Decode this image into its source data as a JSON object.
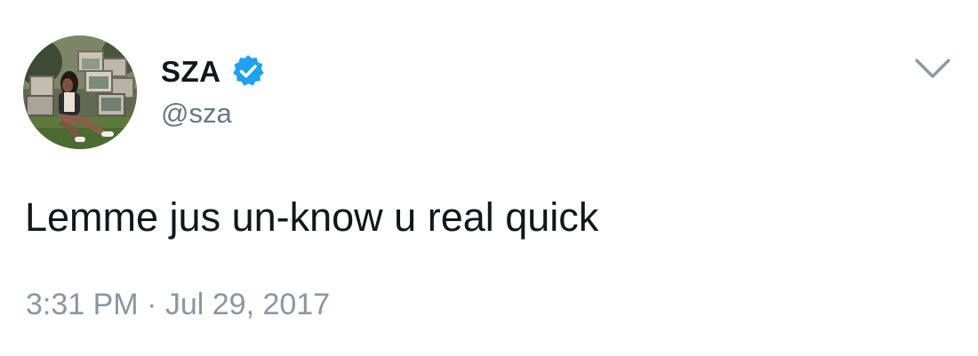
{
  "tweet": {
    "display_name": "SZA",
    "handle": "@sza",
    "verified": true,
    "avatar": "profile-photo",
    "text": "Lemme jus un-know u real quick",
    "time": "3:31 PM",
    "separator": "·",
    "date": "Jul 29, 2017",
    "menu_icon": "chevron-down-icon"
  },
  "colors": {
    "text": "#14171a",
    "secondary": "#657786",
    "timestamp": "#8a96a3",
    "verified_badge": "#1da1f2",
    "caret": "#8899a6"
  }
}
